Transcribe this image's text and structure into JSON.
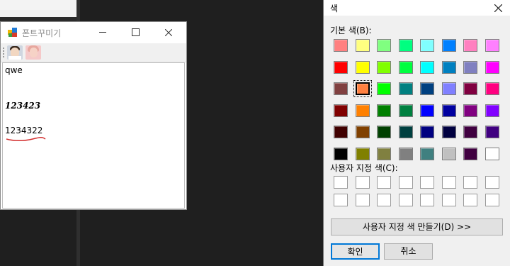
{
  "font_window": {
    "title": "폰트꾸미기",
    "text_lines": [
      "qwe",
      "123423",
      "1234322"
    ]
  },
  "color_dialog": {
    "title": "색",
    "basic_colors_label": "기본 색(B):",
    "custom_colors_label": "사용자 지정 색(C):",
    "define_custom_button": "사용자 지정 색 만들기(D) >>",
    "ok_button": "확인",
    "cancel_button": "취소",
    "basic_colors": [
      [
        "#ff8080",
        "#ffff80",
        "#80ff80",
        "#00ff80",
        "#80ffff",
        "#0080ff",
        "#ff80c0",
        "#ff80ff"
      ],
      [
        "#ff0000",
        "#ffff00",
        "#80ff00",
        "#00ff40",
        "#00ffff",
        "#0080c0",
        "#8080c0",
        "#ff00ff"
      ],
      [
        "#804040",
        "#ff8040",
        "#00ff00",
        "#008080",
        "#004080",
        "#8080ff",
        "#800040",
        "#ff0080"
      ],
      [
        "#800000",
        "#ff8000",
        "#008000",
        "#008040",
        "#0000ff",
        "#0000a0",
        "#800080",
        "#8000ff"
      ],
      [
        "#400000",
        "#804000",
        "#004000",
        "#004040",
        "#000080",
        "#000040",
        "#400040",
        "#400080"
      ],
      [
        "#000000",
        "#808000",
        "#808040",
        "#808080",
        "#408080",
        "#c0c0c0",
        "#400040",
        "#ffffff"
      ]
    ],
    "selected_color": "#ff8040",
    "custom_colors": [
      [
        "#ffffff",
        "#ffffff",
        "#ffffff",
        "#ffffff",
        "#ffffff",
        "#ffffff",
        "#ffffff",
        "#ffffff"
      ],
      [
        "#ffffff",
        "#ffffff",
        "#ffffff",
        "#ffffff",
        "#ffffff",
        "#ffffff",
        "#ffffff",
        "#ffffff"
      ]
    ]
  },
  "colors": {
    "accent": "#0078d7",
    "underline": "#d32f2f"
  }
}
